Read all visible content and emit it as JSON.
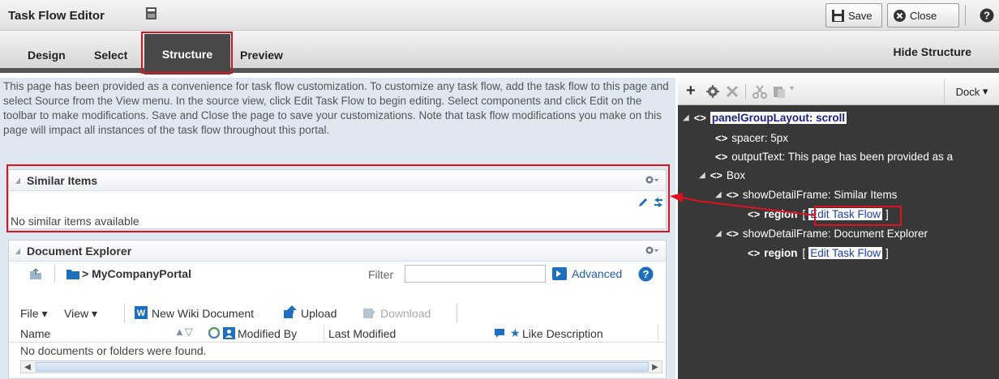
{
  "header": {
    "title": "Task Flow Editor",
    "save_label": "Save",
    "close_label": "Close"
  },
  "tabs": [
    {
      "label": "Design"
    },
    {
      "label": "Select"
    },
    {
      "label": "Structure"
    },
    {
      "label": "Preview"
    }
  ],
  "hide_structure_label": "Hide Structure",
  "intro_text": "This page has been provided as a convenience for task flow customization. To customize any task flow, add the task flow to this page and select Source from the View menu. In the source view, click Edit Task Flow to begin editing. Select components and click Edit on the toolbar to make modifications. Save and Close the page to save your customizations. Note that task flow modifications you make on this page will impact all instances of the task flow throughout this portal.",
  "similar_items": {
    "title": "Similar Items",
    "empty_text": "No similar items available"
  },
  "document_explorer": {
    "title": "Document Explorer",
    "breadcrumb": "> MyCompanyPortal",
    "filter_label": "Filter",
    "filter_value": "",
    "advanced_label": "Advanced",
    "file_menu": "File",
    "view_menu": "View",
    "new_wiki_label": "New Wiki Document",
    "upload_label": "Upload",
    "download_label": "Download",
    "columns": {
      "name": "Name",
      "modified_by": "Modified By",
      "last_modified": "Last Modified",
      "like_description": "Like Description"
    },
    "empty_text": "No documents or folders were found."
  },
  "structure": {
    "dock_label": "Dock",
    "nodes": {
      "root": "panelGroupLayout: scroll",
      "spacer": "spacer: 5px",
      "output": "outputText: This page has been provided as a",
      "box": "Box",
      "sdf1": "showDetailFrame: Similar Items",
      "region_label": "region",
      "edit_link": "Edit Task Flow",
      "sdf2": "showDetailFrame: Document Explorer"
    }
  },
  "colors": {
    "highlight": "#e0111f",
    "tree_bg": "#383838",
    "content_bg": "#dfe8f1",
    "link": "#1a3fb4"
  }
}
